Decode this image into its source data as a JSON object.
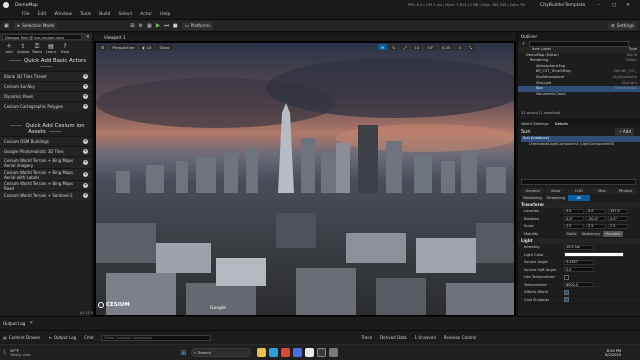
{
  "titlebar": {
    "app_tab": "DemoMap",
    "stats": "FPS: 6.2 | 109.1 ms | Mem: 7,813.13 MB | Objs: 165,349 | Calls: 90",
    "project_name": "CityBuilderTemplate"
  },
  "menu": [
    "File",
    "Edit",
    "Window",
    "Tools",
    "Build",
    "Select",
    "Actor",
    "Help"
  ],
  "toolbar": {
    "mode_label": "Selection Mode",
    "platforms_label": "Platforms",
    "settings_label": "Settings"
  },
  "cesium_panel": {
    "account": "Geospo Test @ ion.cesium.com",
    "tools": [
      "Add",
      "Upload",
      "Token",
      "Learn",
      "Help"
    ],
    "basic_title": "Quick Add Basic Actors",
    "basic_items": [
      "Blank 3D Tiles Tileset",
      "Cesium SunSky",
      "Dynamic Pawn",
      "Cesium Cartographic Polygon"
    ],
    "ion_title": "Quick Add Cesium ion Assets",
    "ion_items": [
      "Cesium OSM Buildings",
      "Google Photorealistic 3D Tiles",
      "Cesium World Terrain + Bing Maps Aerial imagery",
      "Cesium World Terrain + Bing Maps Aerial with Labels",
      "Cesium World Terrain + Bing Maps Road",
      "Cesium World Terrain + Sentinel-2"
    ],
    "version": "v2.11.0"
  },
  "viewport": {
    "tab_label": "Viewport 1",
    "view_label": "Perspective",
    "lit_label": "Lit",
    "show_label": "Show",
    "snap_value": "10",
    "angle_value": "10°",
    "scale_value": "0.25",
    "camera_speed": "4",
    "watermark": "CESIUM",
    "attribution": "Google"
  },
  "outliner": {
    "title": "Outliner",
    "col_label": "Item Label",
    "col_type": "Type",
    "rows": [
      {
        "label": "DemoMap (Editor)",
        "type": "World",
        "selected": false
      },
      {
        "label": "Rendering",
        "type": "Folder",
        "selected": false
      },
      {
        "label": "AtmosphericFog",
        "type": "",
        "selected": false
      },
      {
        "label": "BP_CST_TimeOfDay",
        "type": "Edit BP_CST_",
        "selected": false
      },
      {
        "label": "SkyAtmosphere",
        "type": "SkyAtmosphe",
        "selected": false
      },
      {
        "label": "SkyLight",
        "type": "SkyLight",
        "selected": false
      },
      {
        "label": "Sun",
        "type": "DirectionalLi",
        "selected": true
      },
      {
        "label": "VolumetricCloud",
        "type": "",
        "selected": false
      }
    ],
    "footer": "31 actors (1 selected)"
  },
  "details": {
    "tabs": [
      "World Settings",
      "Details"
    ],
    "actor_name": "Sun",
    "add_label": "Add",
    "components": [
      "Sun (Instance)",
      "DirectionalLightComponent (LightComponent0)"
    ],
    "search_placeholder": "Search",
    "categories": [
      "General",
      "Actor",
      "LOD",
      "Misc",
      "Physics",
      "Rendering",
      "Streaming",
      "All"
    ],
    "transform_title": "Transform",
    "transform": [
      {
        "label": "Location",
        "values": [
          "0.0",
          "0.0",
          "337.5"
        ]
      },
      {
        "label": "Rotation",
        "values": [
          "0.0°",
          "-50.4°",
          "0.0°"
        ]
      },
      {
        "label": "Scale",
        "values": [
          "2.5",
          "2.5",
          "2.5"
        ]
      }
    ],
    "mobility_label": "Mobility",
    "mobility_options": [
      "Static",
      "Stationary",
      "Movable"
    ],
    "light_title": "Light",
    "light_props": [
      {
        "label": "Intensity",
        "value": "10.0 lux"
      },
      {
        "label": "Light Color",
        "value": ""
      },
      {
        "label": "Source Angle",
        "value": "0.5357"
      },
      {
        "label": "Source Soft Angle",
        "value": "0.0"
      },
      {
        "label": "Use Temperature",
        "value": ""
      },
      {
        "label": "Temperature",
        "value": "6500.0"
      },
      {
        "label": "Affects World",
        "value": ""
      },
      {
        "label": "Cast Shadows",
        "value": ""
      }
    ]
  },
  "bottom": {
    "output_log": "Output Log",
    "content_drawer": "Content Drawer",
    "output_log_tab": "Output Log",
    "cmd_label": "Cmd",
    "cmd_placeholder": "Enter Console Command",
    "trace": "Trace",
    "derived_data": "Derived Data",
    "unsaved": "1 Unsaved",
    "revision_control": "Revision Control"
  },
  "taskbar": {
    "weather_temp": "67°F",
    "weather_text": "Mostly clear",
    "search_placeholder": "Search",
    "time": "8:30 PM",
    "date": "5/2/2025"
  },
  "colors": {
    "accent": "#0a5fa0",
    "selected_row": "#2f4f78",
    "play_green": "#5fbf4a"
  }
}
